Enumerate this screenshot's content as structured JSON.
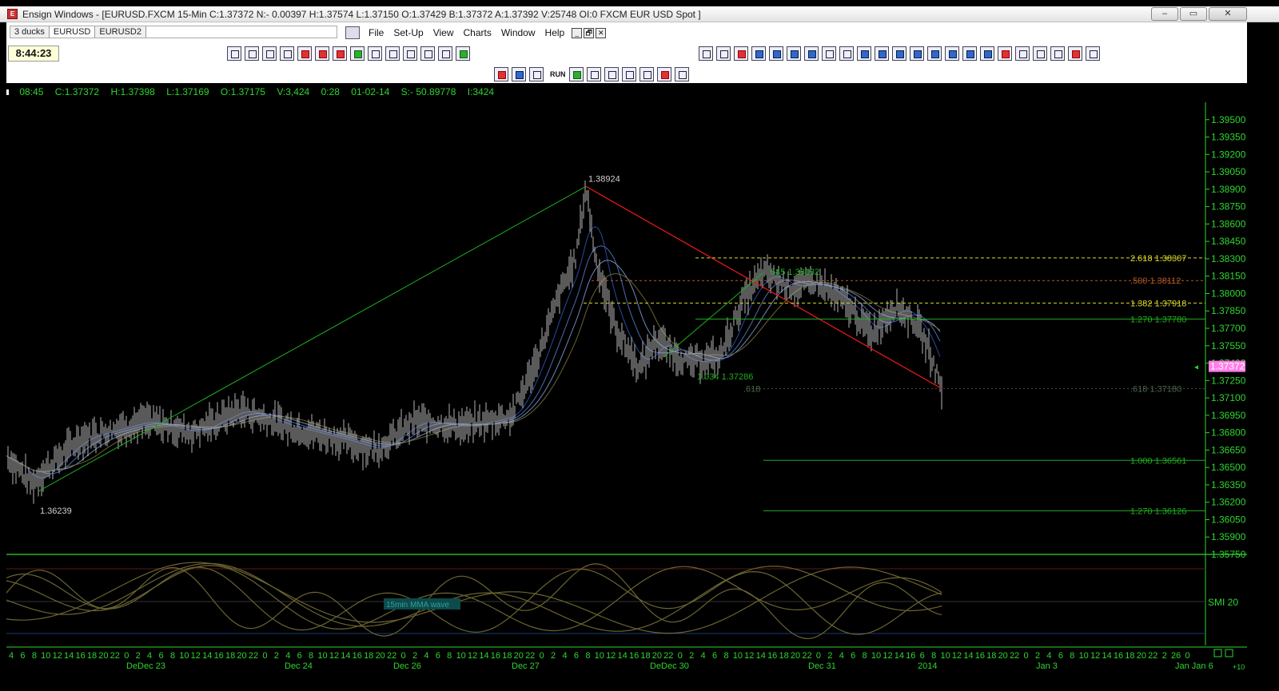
{
  "window": {
    "title": "Ensign Windows - [EURUSD.FXCM 15-Min C:1.37372 N:- 0.00397 H:1.37574 L:1.37150 O:1.37429 B:1.37372 A:1.37392 V:25748 OI:0 FXCM EUR USD Spot ]",
    "minimize_label": "–",
    "restore_label": "▭",
    "close_label": "✕"
  },
  "tabs": [
    {
      "label": "3 ducks"
    },
    {
      "label": "EURUSD"
    },
    {
      "label": "EURUSD2"
    }
  ],
  "menu": [
    "File",
    "Set-Up",
    "View",
    "Charts",
    "Window",
    "Help"
  ],
  "mdi_buttons": [
    "_",
    "🗗",
    "✕"
  ],
  "clock": "8:44:23",
  "toolbar": {
    "run_label": "RUN",
    "row1_icons": [
      "window-icon",
      "tile-icon",
      "quote-icon",
      "options-icon",
      "fire-icon",
      "bar-chart-icon",
      "n-icon",
      "dollar-icon",
      "scan-icon",
      "news-icon",
      "camera-icon",
      "esp-icon",
      "print-icon",
      "exit-icon"
    ],
    "row2_icons": [
      "line-tool-icon",
      "pencil-icon",
      "arrow-icon",
      "fan-icon",
      "fib-icon",
      "gann-icon",
      "grid-icon",
      "p-icon",
      "a-icon",
      "channel-icon",
      "regression-icon",
      "bar-tool-icon",
      "cycles-icon",
      "circle-icon",
      "fib-ext-icon",
      "lines-icon",
      "trend-icon",
      "alarm-icon",
      "andrews-icon",
      "text-a-icon",
      "n-text-icon",
      "delete-tool-icon",
      "trash-icon"
    ],
    "row3_icons": [
      "compass-icon",
      "wave-icon",
      "bars-icon",
      "run-icon",
      "lock-icon",
      "lock-icon-2",
      "globe-icon",
      "stick-icon",
      "candle-icon",
      "curve-icon"
    ]
  },
  "infobar": {
    "time": "08:45",
    "close": "C:1.37372",
    "high": "H:1.37398",
    "low": "L:1.37169",
    "open": "O:1.37175",
    "volume": "V:3,424",
    "duration": "0:28",
    "date": "01-02-14",
    "s": "S:- 50.89778",
    "i": "I:3424"
  },
  "colors": {
    "bar": "#b4b4b4",
    "axis": "#2fd52f",
    "up_line": "#1fae1f",
    "down_line": "#e01818",
    "fib_orange": "#b55a2a",
    "fib_yellow": "#d8d82a",
    "fib_green": "#1fae1f",
    "indicator": "#6b6430",
    "price_box": "#ff7ee8"
  },
  "chart_data": {
    "type": "line",
    "ylim": [
      1.3575,
      1.3965
    ],
    "y_ticks": [
      "1.39500",
      "1.39350",
      "1.39200",
      "1.39050",
      "1.38900",
      "1.38750",
      "1.38600",
      "1.38450",
      "1.38300",
      "1.38150",
      "1.38000",
      "1.37850",
      "1.37700",
      "1.37550",
      "1.37400",
      "1.37250",
      "1.37100",
      "1.36950",
      "1.36800",
      "1.36650",
      "1.36500",
      "1.36350",
      "1.36200",
      "1.36050",
      "1.35900",
      "1.35750"
    ],
    "current_price": "1.37372",
    "swing_labels": [
      {
        "text": "1.38924",
        "price": 1.38924
      },
      {
        "text": "1.36239",
        "price": 1.36239
      }
    ],
    "retracement_labels": [
      {
        "text": "545  1.38182",
        "price": 1.38182
      },
      {
        "text": "1.034  1.37286",
        "price": 1.37286
      },
      {
        "text": ".618",
        "price": 1.3718
      }
    ],
    "fib_levels": [
      {
        "text": "2.618  1.38307",
        "price": 1.38307
      },
      {
        "text": ".500  1.38112",
        "price": 1.38112
      },
      {
        "text": "1.382  1.37918",
        "price": 1.37918
      },
      {
        "text": "1.270  1.37780",
        "price": 1.3778
      },
      {
        "text": ".618  1.37180",
        "price": 1.3718
      },
      {
        "text": "1.000  1.36561",
        "price": 1.36561
      },
      {
        "text": "1.270  1.36126",
        "price": 1.36126
      }
    ],
    "indicator_label": "SMI  20",
    "indicator_tag": "15min MMA wave",
    "x_hour_labels": "4 6 8 10 12 14 16 18 20 22 0 2 4 6 8 10 12 14 16 18 20 22 0 2 4 6 8 10 12 14 16 18 20 22 0 2 4 6 8 10 12 14 16 18 20 22 0 2 4 6 8 10 12 14 16 18 20 22 0 2 4 6 8 10 12 14 16 18 20 22 0 2 4 6 8 10 12 14 16 6 8 10 12 14 16 18 20 22 0 2 4 6 8 10 12 14 16 18 20 22 2 26 0",
    "x_day_labels": [
      {
        "text": "DeDec 23"
      },
      {
        "text": "Dec 24"
      },
      {
        "text": "Dec 26"
      },
      {
        "text": "Dec 27"
      },
      {
        "text": "DeDec 30"
      },
      {
        "text": "Dec 31"
      },
      {
        "text": "2014"
      },
      {
        "text": "Jan 3"
      },
      {
        "text": "Jan Jan 6"
      }
    ],
    "x_scale_label": "+10"
  }
}
